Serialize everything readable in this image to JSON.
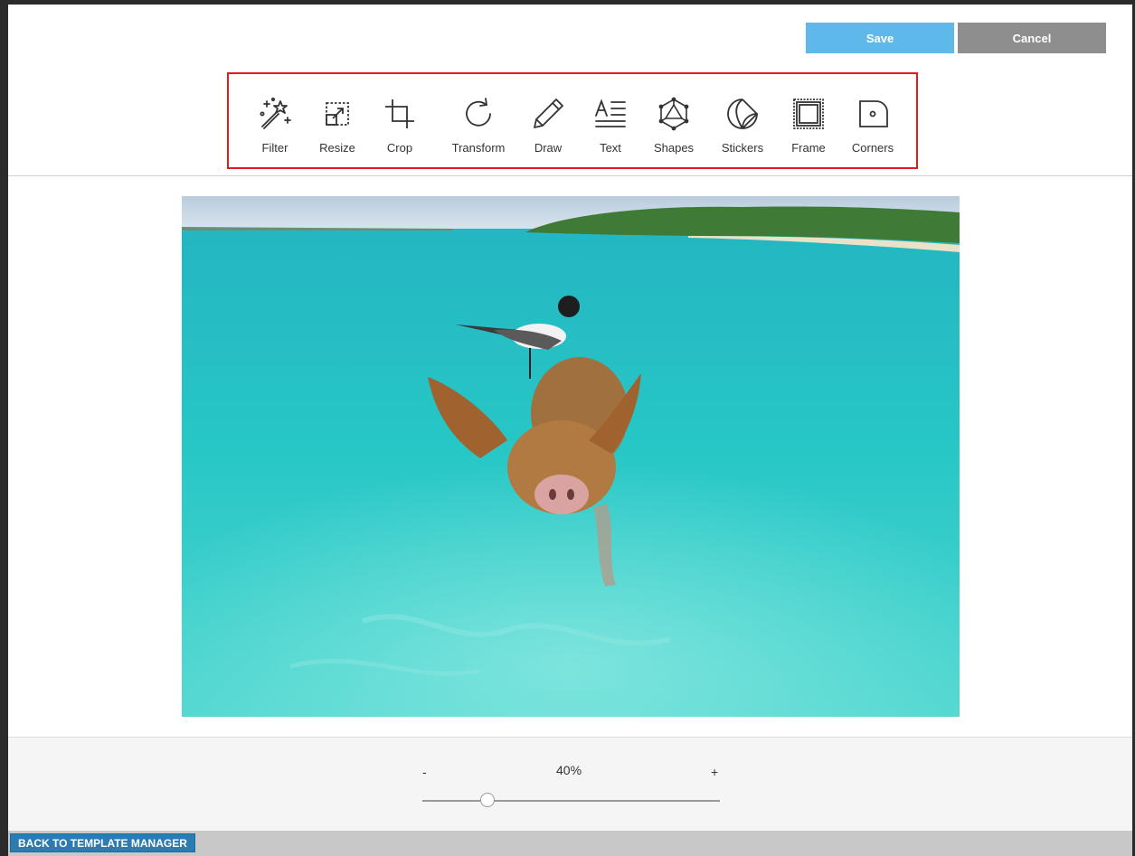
{
  "header": {
    "save_label": "Save",
    "cancel_label": "Cancel"
  },
  "toolbar": {
    "highlight_color": "#e01c1c",
    "tools": [
      {
        "label": "Filter",
        "icon": "magic-wand-icon"
      },
      {
        "label": "Resize",
        "icon": "resize-icon"
      },
      {
        "label": "Crop",
        "icon": "crop-icon"
      },
      {
        "label": "Transform",
        "icon": "rotate-icon"
      },
      {
        "label": "Draw",
        "icon": "pencil-icon"
      },
      {
        "label": "Text",
        "icon": "text-icon"
      },
      {
        "label": "Shapes",
        "icon": "shapes-icon"
      },
      {
        "label": "Stickers",
        "icon": "sticker-icon"
      },
      {
        "label": "Frame",
        "icon": "frame-icon"
      },
      {
        "label": "Corners",
        "icon": "corners-icon"
      }
    ]
  },
  "zoom": {
    "minus_label": "-",
    "value_label": "40%",
    "plus_label": "+",
    "level_fraction": 0.22
  },
  "footer": {
    "back_label": "BACK TO TEMPLATE MANAGER"
  },
  "colors": {
    "save": "#5fb8ea",
    "cancel": "#8e8e8e",
    "back": "#2c7cb2"
  }
}
